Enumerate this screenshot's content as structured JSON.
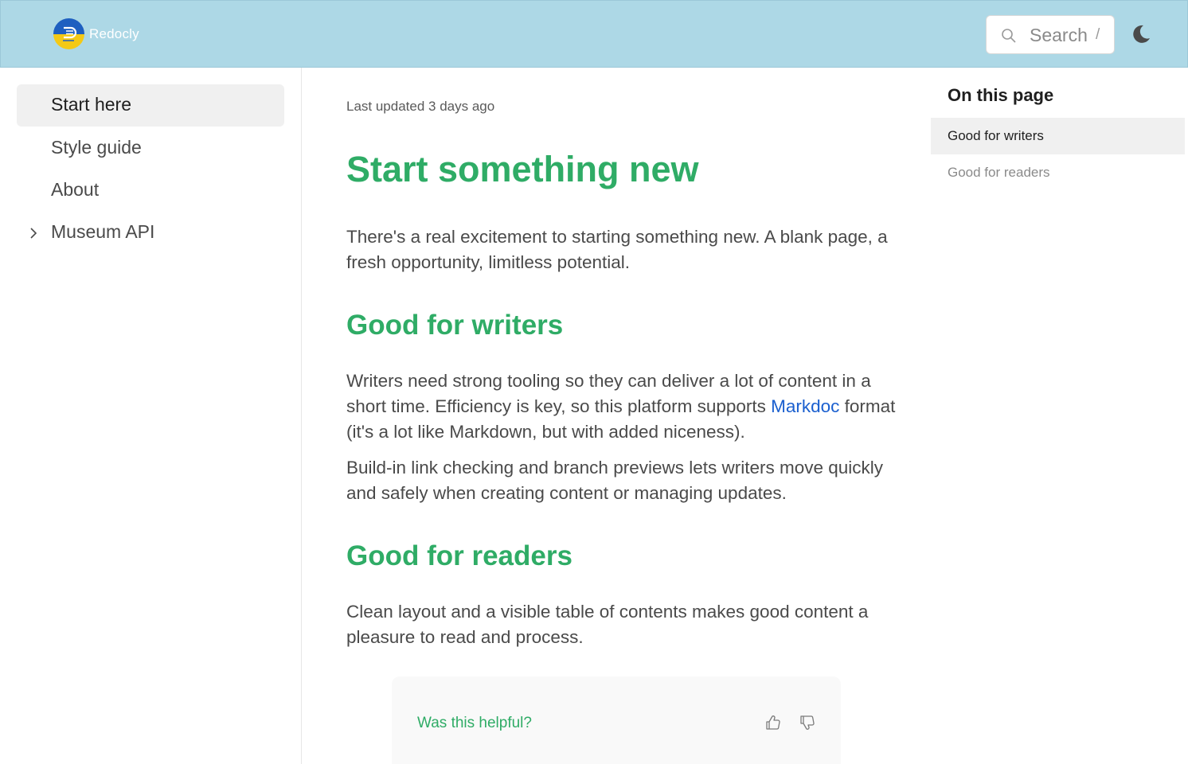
{
  "header": {
    "logo_text": "Redocly",
    "search_placeholder": "Search",
    "search_shortcut": "/",
    "theme_icon": "moon-icon",
    "colors": {
      "navbar_bg": "#add8e6"
    }
  },
  "sidebar": {
    "items": [
      {
        "label": "Start here",
        "active": true
      },
      {
        "label": "Style guide",
        "active": false
      },
      {
        "label": "About",
        "active": false
      },
      {
        "label": "Museum API",
        "active": false,
        "expandable": true
      }
    ]
  },
  "main": {
    "last_updated": "Last updated 3 days ago",
    "title": "Start something new",
    "intro": "There's a real excitement to starting something new. A blank page, a fresh opportunity, limitless potential.",
    "sections": [
      {
        "heading": "Good for writers",
        "p1_before": "Writers need strong tooling so they can deliver a lot of content in a short time. Efficiency is key, so this platform supports ",
        "p1_link": "Markdoc",
        "p1_after": " format (it's a lot like Markdown, but with added niceness).",
        "p2": "Build-in link checking and branch previews lets writers move quickly and safely when creating content or managing updates."
      },
      {
        "heading": "Good for readers",
        "p1": "Clean layout and a visible table of contents makes good content a pleasure to read and process."
      }
    ],
    "feedback": {
      "question": "Was this helpful?",
      "up_icon": "thumbs-up-icon",
      "down_icon": "thumbs-down-icon"
    },
    "colors": {
      "heading": "#2fac66",
      "link": "#1a5fcf"
    }
  },
  "toc": {
    "title": "On this page",
    "items": [
      {
        "label": "Good for writers",
        "active": true
      },
      {
        "label": "Good for readers",
        "active": false
      }
    ]
  }
}
